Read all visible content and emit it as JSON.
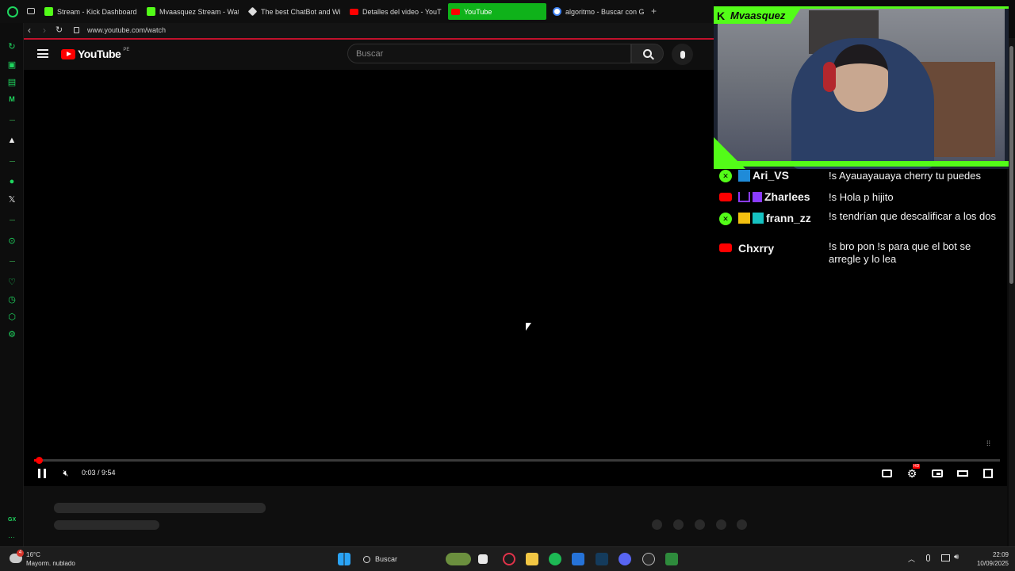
{
  "browser": {
    "tabs": [
      {
        "label": "Stream - Kick Dashboard",
        "icon": "kick-icon",
        "color": "#53fc18"
      },
      {
        "label": "Mvaasquez Stream - Wat",
        "icon": "kick-icon",
        "color": "#53fc18"
      },
      {
        "label": "The best ChatBot and Wi",
        "icon": "chatbot-icon",
        "color": "#dddddd"
      },
      {
        "label": "Detalles del video - YouT",
        "icon": "youtube-icon",
        "color": "#ff0000"
      },
      {
        "label": "YouTube",
        "icon": "youtube-icon",
        "color": "#ff0000",
        "active": true
      },
      {
        "label": "algoritmo - Buscar con G",
        "icon": "google-icon",
        "color": "#4285f4"
      }
    ],
    "new_tab": "+",
    "url": "www.youtube.com/watch"
  },
  "youtube": {
    "logo_text": "YouTube",
    "region": "PE",
    "search_placeholder": "Buscar",
    "player": {
      "current_time": "0:03",
      "duration": "9:54",
      "time_display": "0:03 / 9:54",
      "progress_fraction": 0.005,
      "hd_badge": "HD"
    }
  },
  "overlay": {
    "streamer_name": "Mvaasquez",
    "brand_color": "#53fc18",
    "chat": [
      {
        "platform": "kick",
        "user": "Ari_VS",
        "text": "!s Ayauayauaya cherry tu puedes"
      },
      {
        "platform": "youtube",
        "user": "Zharlees",
        "text": "!s Hola p hijito"
      },
      {
        "platform": "kick",
        "user": "frann_zz",
        "text": "!s tendrían que descalificar a los dos"
      },
      {
        "platform": "youtube",
        "user": "Chxrry",
        "text": "!s bro pon !s para que el bot se arregle y lo lea"
      }
    ]
  },
  "sidebar": {
    "bottom_label": "GX"
  },
  "taskbar": {
    "weather_temp": "16°C",
    "weather_desc": "Mayorm. nublado",
    "weather_badge": "4",
    "search_label": "Buscar",
    "time": "22:09",
    "date": "10/09/2025"
  }
}
